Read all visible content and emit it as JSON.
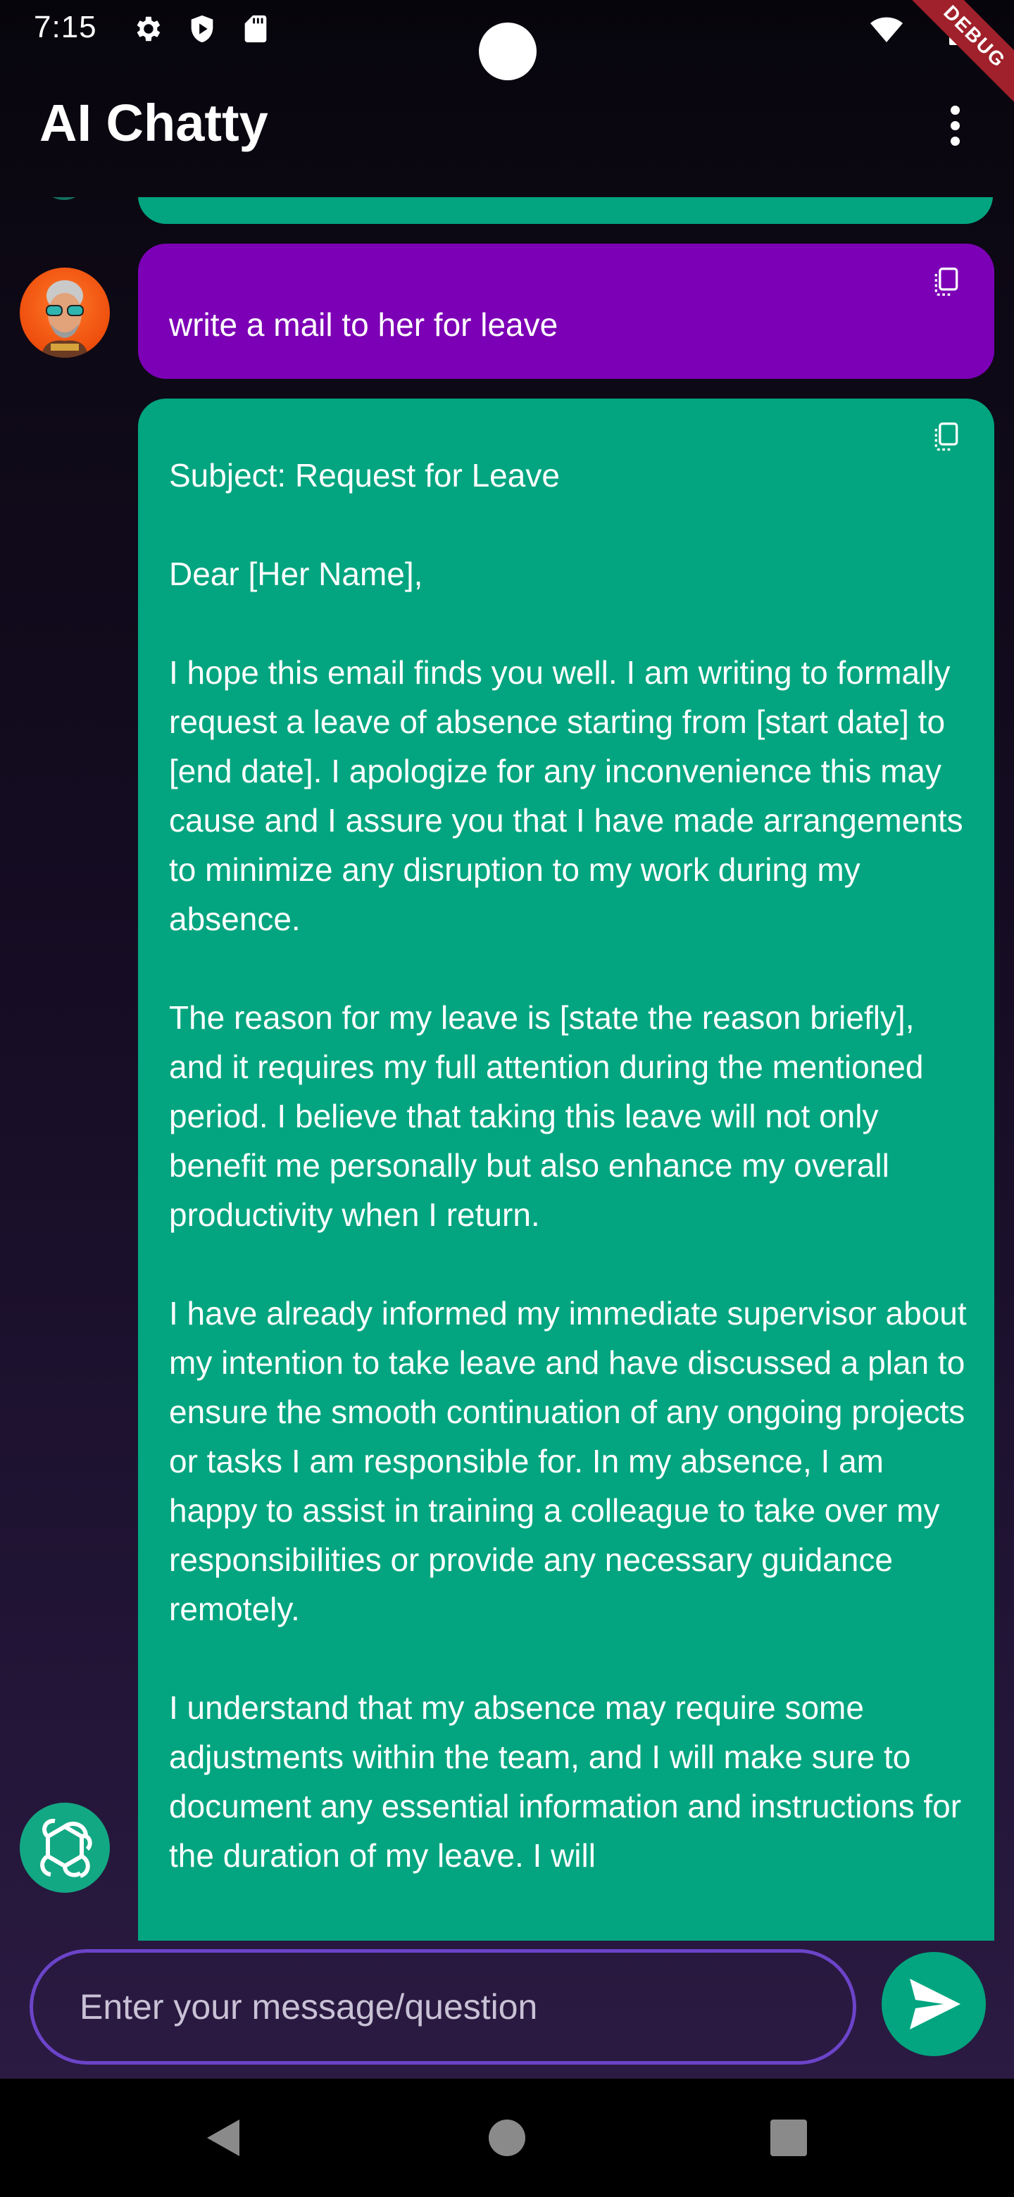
{
  "status_bar": {
    "time": "7:15",
    "icons": [
      "gear-icon",
      "shield-play-icon",
      "sd-card-icon",
      "wifi-icon",
      "battery-icon"
    ],
    "debug_label": "DEBUG"
  },
  "app_bar": {
    "title": "AI Chatty",
    "menu_icon": "more-vert-icon"
  },
  "messages": [
    {
      "role": "user",
      "text": "write a mail to her for leave",
      "bubble_color": "#7c00b5"
    },
    {
      "role": "assistant",
      "bubble_color": "#02a57f",
      "text": "Subject: Request for Leave\n\nDear [Her Name],\n\nI hope this email finds you well. I am writing to formally request a leave of absence starting from [start date] to [end date]. I apologize for any inconvenience this may cause and I assure you that I have made arrangements to minimize any disruption to my work during my absence.\n\nThe reason for my leave is [state the reason briefly], and it requires my full attention during the mentioned period. I believe that taking this leave will not only benefit me personally but also enhance my overall productivity when I return.\n\nI have already informed my immediate supervisor about my intention to take leave and have discussed a plan to ensure the smooth continuation of any ongoing projects or tasks I am responsible for. In my absence, I am happy to assist in training a colleague to take over my responsibilities or provide any necessary guidance remotely.\n\nI understand that my absence may require some adjustments within the team, and I will make sure to document any essential information and instructions for the duration of my leave. I will"
    }
  ],
  "input": {
    "placeholder": "Enter your message/question",
    "value": ""
  },
  "colors": {
    "accent_green": "#02a57f",
    "user_purple": "#7c00b5",
    "input_border": "#6b44c9",
    "debug_red": "#a0212b"
  },
  "nav_bar": {
    "icons": [
      "back-icon",
      "home-icon",
      "recents-icon"
    ]
  }
}
